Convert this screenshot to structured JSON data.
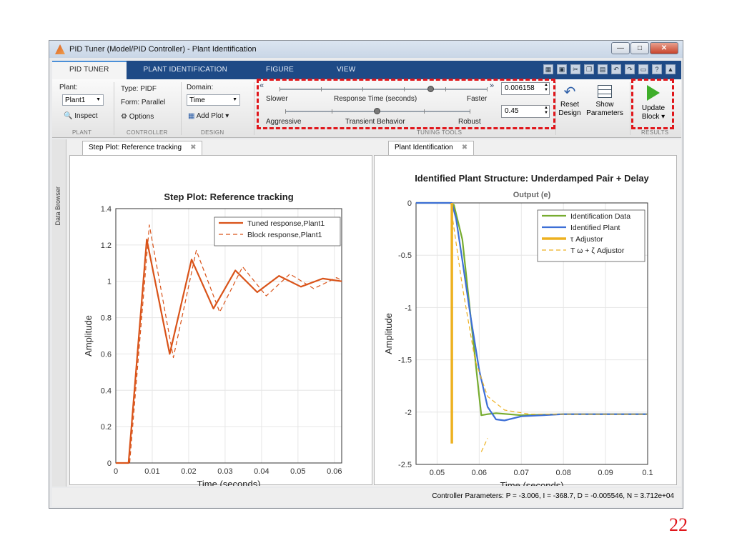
{
  "window": {
    "title": "PID Tuner (Model/PID Controller) - Plant Identification"
  },
  "ribbon_tabs": [
    "PID TUNER",
    "PLANT IDENTIFICATION",
    "FIGURE",
    "VIEW"
  ],
  "plant": {
    "label": "Plant:",
    "value": "Plant1",
    "inspect": "Inspect",
    "section": "PLANT"
  },
  "controller": {
    "type": "Type: PIDF",
    "form": "Form: Parallel",
    "options": "Options",
    "section": "CONTROLLER"
  },
  "design": {
    "label": "Domain:",
    "value": "Time",
    "add_plot": "Add Plot",
    "section": "DESIGN"
  },
  "tuning": {
    "slower": "Slower",
    "response_time": "Response Time (seconds)",
    "faster": "Faster",
    "response_value": "0.006158",
    "response_fraction": 0.73,
    "aggressive": "Aggressive",
    "transient": "Transient Behavior",
    "robust": "Robust",
    "transient_value": "0.45",
    "transient_fraction": 0.5,
    "section": "TUNING TOOLS"
  },
  "actions": {
    "reset": "Reset",
    "reset2": "Design",
    "show": "Show",
    "show2": "Parameters",
    "update": "Update",
    "update2": "Block",
    "section": "RESULTS"
  },
  "sidebar": {
    "label": "Data Browser"
  },
  "doc_tabs": {
    "left": "Step Plot: Reference tracking",
    "right": "Plant Identification"
  },
  "status": {
    "text": "Controller Parameters: P = -3.006, I = -368.7, D = -0.005546, N = 3.712e+04"
  },
  "slide_number": "22",
  "colors": {
    "accent_red": "#e0151a",
    "tuned": "#d95319",
    "identified": "#3d6fd6",
    "data": "#77ac30",
    "adjustor": "#edb120"
  },
  "chart_data": [
    {
      "type": "line",
      "title": "Step Plot: Reference tracking",
      "xlabel": "Time (seconds)",
      "ylabel": "Amplitude",
      "xlim": [
        0,
        0.062
      ],
      "ylim": [
        0,
        1.4
      ],
      "xticks": [
        0,
        0.01,
        0.02,
        0.03,
        0.04,
        0.05,
        0.06
      ],
      "xtick_labels": [
        "0",
        "0.01",
        "0.02",
        "0.03",
        "0.04",
        "0.05",
        "0.06"
      ],
      "yticks": [
        0,
        0.2,
        0.4,
        0.6,
        0.8,
        1,
        1.2,
        1.4
      ],
      "ytick_labels": [
        "0",
        "0.2",
        "0.4",
        "0.6",
        "0.8",
        "1",
        "1.2",
        "1.4"
      ],
      "legend_position": "top-right",
      "series": [
        {
          "name": "Tuned response,Plant1",
          "color": "#d95319",
          "style": "solid",
          "x": [
            0,
            0.0035,
            0.0085,
            0.0148,
            0.0208,
            0.0268,
            0.0328,
            0.0388,
            0.0448,
            0.0508,
            0.0568,
            0.062
          ],
          "y": [
            0,
            0,
            1.23,
            0.6,
            1.12,
            0.85,
            1.06,
            0.94,
            1.03,
            0.97,
            1.015,
            1.0
          ]
        },
        {
          "name": "Block response,Plant1",
          "color": "#d95319",
          "style": "dashed",
          "x": [
            0,
            0.0038,
            0.0092,
            0.0158,
            0.0221,
            0.0285,
            0.0348,
            0.0413,
            0.0478,
            0.0543,
            0.0606,
            0.062
          ],
          "y": [
            0,
            0,
            1.31,
            0.58,
            1.17,
            0.83,
            1.08,
            0.92,
            1.04,
            0.96,
            1.02,
            1.005
          ]
        }
      ]
    },
    {
      "type": "line",
      "title": "Identified Plant Structure: Underdamped Pair + Delay",
      "subtitle": "Output (e)",
      "xlabel": "Time (seconds)",
      "ylabel": "Amplitude",
      "xlim": [
        0.045,
        0.1
      ],
      "ylim": [
        -2.5,
        0
      ],
      "xticks": [
        0.05,
        0.06,
        0.07,
        0.08,
        0.09,
        0.1
      ],
      "xtick_labels": [
        "0.05",
        "0.06",
        "0.07",
        "0.08",
        "0.09",
        "0.1"
      ],
      "yticks": [
        0,
        -0.5,
        -1,
        -1.5,
        -2,
        -2.5
      ],
      "ytick_labels": [
        "0",
        "-0.5",
        "-1",
        "-1.5",
        "-2",
        "-2.5"
      ],
      "legend_position": "top-right",
      "series": [
        {
          "name": "Identification Data",
          "color": "#77ac30",
          "style": "solid",
          "x": [
            0.045,
            0.053,
            0.054,
            0.056,
            0.058,
            0.06,
            0.0605,
            0.062,
            0.064,
            0.07,
            0.08,
            0.1
          ],
          "y": [
            0,
            0,
            -0.02,
            -0.35,
            -1.1,
            -1.85,
            -2.03,
            -2.02,
            -2.01,
            -2.03,
            -2.02,
            -2.02
          ]
        },
        {
          "name": "Identified Plant",
          "color": "#3d6fd6",
          "style": "solid",
          "x": [
            0.045,
            0.0535,
            0.0545,
            0.056,
            0.058,
            0.06,
            0.062,
            0.064,
            0.066,
            0.07,
            0.08,
            0.1
          ],
          "y": [
            0,
            0,
            -0.15,
            -0.55,
            -1.1,
            -1.6,
            -1.95,
            -2.07,
            -2.08,
            -2.04,
            -2.02,
            -2.02
          ]
        },
        {
          "name": "τ Adjustor",
          "color": "#edb120",
          "style": "thick",
          "x": [
            0.0535,
            0.0535
          ],
          "y": [
            0,
            -2.3
          ]
        },
        {
          "name": "T ω + ζ Adjustor",
          "color": "#edb120",
          "style": "dashed",
          "x": [
            0.0535,
            0.056,
            0.059,
            0.062,
            0.066,
            0.072,
            0.08,
            0.1
          ],
          "y": [
            -0.1,
            -0.8,
            -1.5,
            -1.85,
            -1.98,
            -2.02,
            -2.02,
            -2.02
          ],
          "extra_x": [
            0.0605,
            0.062
          ],
          "extra_y": [
            -2.38,
            -2.25
          ]
        }
      ]
    }
  ]
}
